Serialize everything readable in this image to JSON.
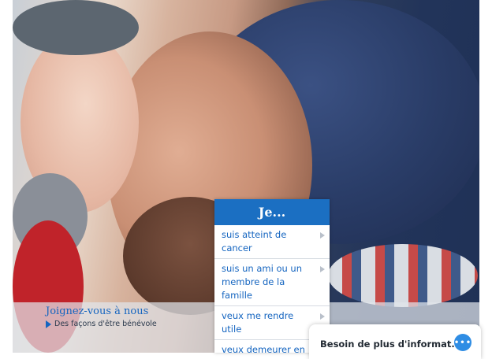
{
  "menu": {
    "header": "Je...",
    "items": [
      {
        "label": "suis atteint de cancer"
      },
      {
        "label": "suis un ami ou un membre de la famille"
      },
      {
        "label": "veux me rendre utile"
      },
      {
        "label": "veux demeurer en santé"
      }
    ]
  },
  "volunteer": {
    "title": "Joignez-vous à nous",
    "subtitle": "Des façons d'être bénévole"
  },
  "help": {
    "label": "Besoin de plus d'informat...",
    "icon": "chat-bubble-icon",
    "icon_glyph": "•••"
  },
  "colors": {
    "accent": "#1b6fc2",
    "link": "#1565c0"
  }
}
